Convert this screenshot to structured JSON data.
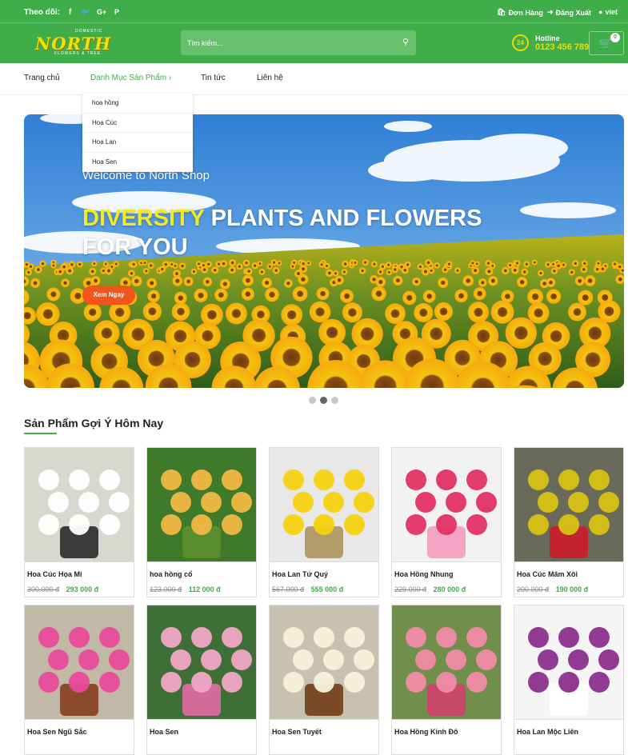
{
  "topbar": {
    "follow_label": "Theo dõi:",
    "social_icons": [
      "facebook-icon",
      "twitter-icon",
      "google-plus-icon",
      "pinterest-icon"
    ],
    "social_glyphs": [
      "f",
      "🐦",
      "G+",
      "P"
    ],
    "orders_label": "Đơn Hàng",
    "logout_label": "Đăng Xuất",
    "user_label": "viet"
  },
  "header": {
    "logo_text": "NORTH",
    "logo_top": "DOMESTIC",
    "logo_bottom": "FLOWERS & TREE",
    "search_placeholder": "Tìm kiếm...",
    "hotline_badge": "24",
    "hotline_label": "Hotline",
    "hotline_number": "0123 456 789",
    "cart_count": "0"
  },
  "nav": {
    "home": "Trang chủ",
    "categories": "Danh Mục Sản Phẩm",
    "news": "Tin tức",
    "contact": "Liên hệ",
    "dropdown": [
      "hoa hồng",
      "Hoa Cúc",
      "Hoa Lan",
      "Hoa Sen"
    ]
  },
  "banner": {
    "welcome": "Welcome to North Shop",
    "highlight": "DIVERSITY",
    "headline_rest": " PLANTS AND FLOWERS FOR YOU",
    "button": "Xem Ngay",
    "slides": 3,
    "active_slide": 2
  },
  "section": {
    "title": "Sản Phẩm Gợi Ý Hôm Nay"
  },
  "products": [
    {
      "name": "Hoa Cúc Họa Mi",
      "old": "300.000 đ",
      "new": "293 000 đ"
    },
    {
      "name": "hoa hồng cổ",
      "old": "123.000 đ",
      "new": "112 000 đ"
    },
    {
      "name": "Hoa Lan Tứ Quý",
      "old": "567.000 đ",
      "new": "555 000 đ"
    },
    {
      "name": "Hoa Hồng Nhung",
      "old": "229.000 đ",
      "new": "280 000 đ"
    },
    {
      "name": "Hoa Cúc Mâm Xôi",
      "old": "200.000 đ",
      "new": "190 000 đ"
    },
    {
      "name": "Hoa Sen Ngũ Sắc",
      "old": "",
      "new": ""
    },
    {
      "name": "Hoa Sen",
      "old": "",
      "new": ""
    },
    {
      "name": "Hoa Sen Tuyết",
      "old": "",
      "new": ""
    },
    {
      "name": "Hoa Hồng Kinh Đô",
      "old": "",
      "new": ""
    },
    {
      "name": "Hoa Lan Mộc Liên",
      "old": "",
      "new": ""
    }
  ],
  "colors": {
    "brand": "#3fae49",
    "accent": "#f5d800",
    "button": "#f0561c"
  }
}
